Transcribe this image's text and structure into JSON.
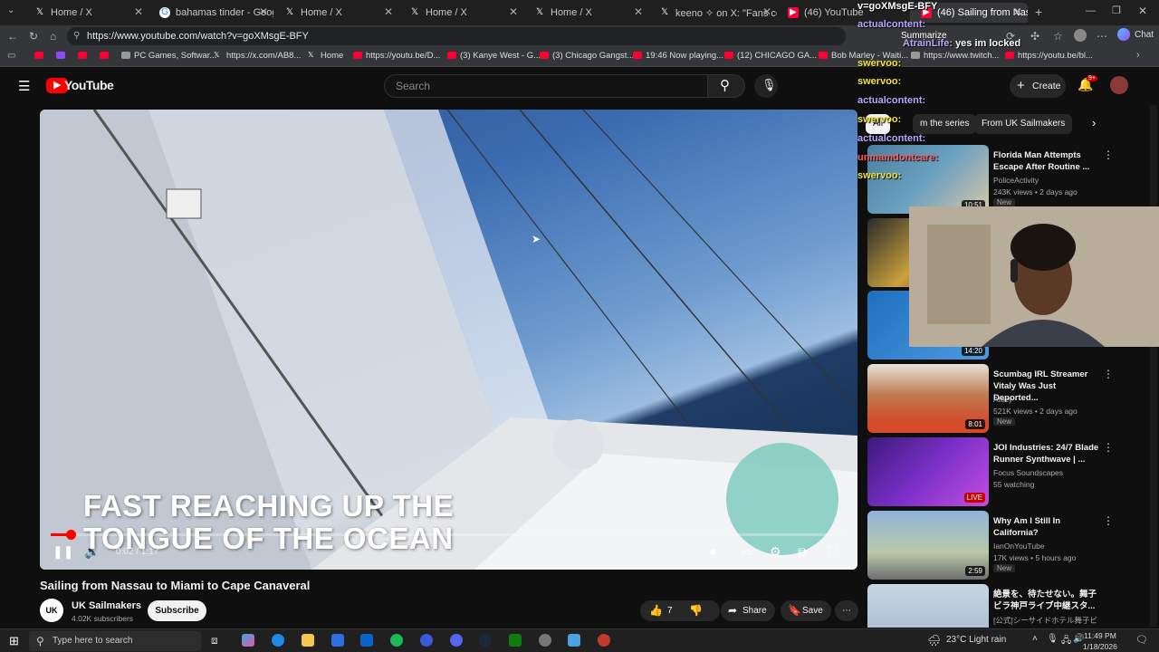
{
  "browser": {
    "tabs": [
      {
        "label": "Home / X",
        "icon": "x-logo-icon"
      },
      {
        "label": "bahamas tinder - Google Se",
        "icon": "google-icon"
      },
      {
        "label": "Home / X",
        "icon": "x-logo-icon"
      },
      {
        "label": "Home / X",
        "icon": "x-logo-icon"
      },
      {
        "label": "Home / X",
        "icon": "x-logo-icon"
      },
      {
        "label": "keeno ✧ on X: \"Fans compa",
        "icon": "x-logo-icon"
      },
      {
        "label": "(46) YouTube",
        "icon": "youtube-icon"
      },
      {
        "label": "(46) Sailing from Nassau",
        "icon": "youtube-icon"
      }
    ],
    "url": "https://www.youtube.com/watch?v=goXMsgE-BFY",
    "bookmarks": [
      "PC Games, Softwar...",
      "https://x.com/AB8...",
      "Home",
      "https://youtu.be/D...",
      "(3) Kanye West - G...",
      "(3) Chicago Gangst...",
      "19:46 Now playing...",
      "(12) CHICAGO GA...",
      "Bob Marley - Waiti...",
      "https://www.twitch...",
      "https://youtu.be/bl..."
    ],
    "summarize_label": "Summarize",
    "chat_label": "Chat"
  },
  "youtube": {
    "logo_text": "YouTube",
    "search_placeholder": "Search",
    "create_label": "Create",
    "notif_count": "9+"
  },
  "video": {
    "caption_line1": "FAST REACHING UP THE",
    "caption_line2": "TONGUE OF THE OCEAN",
    "time": "0:02 / 1:17",
    "progress": 0.026,
    "title": "Sailing from Nassau to Miami to Cape Canaveral",
    "channel": "UK Sailmakers",
    "channel_avatar_text": "UK",
    "subscribers": "4.02K subscribers",
    "subscribe_label": "Subscribe",
    "likes": "7",
    "share_label": "Share",
    "save_label": "Save"
  },
  "chips": [
    "All",
    "m the series",
    "From UK Sailmakers"
  ],
  "recommendations": [
    {
      "title": "Florida Man Attempts Escape After Routine ...",
      "channel": "PoliceActivity",
      "meta": "243K views • 2 days ago",
      "badge": "New",
      "duration": "10:51"
    },
    {
      "title": "",
      "channel": "",
      "meta": "",
      "badge": "",
      "duration": ""
    },
    {
      "title": "",
      "channel": "",
      "meta": "",
      "badge": "",
      "duration": "14:20"
    },
    {
      "title": "Scumbag IRL Streamer Vitaly Was Just Deported...",
      "channel": "Atozy",
      "meta": "521K views • 2 days ago",
      "badge": "New",
      "duration": "8:01"
    },
    {
      "title": "JOI Industries: 24/7 Blade Runner Synthwave | ...",
      "channel": "Focus Soundscapes",
      "meta": "55 watching",
      "badge": "",
      "duration": "LIVE"
    },
    {
      "title": "Why Am I Still In California?",
      "channel": "IanOnYouTube",
      "meta": "17K views • 5 hours ago",
      "badge": "New",
      "duration": "2:59"
    },
    {
      "title": "絶景を、待たせない。舞子ビラ神戸ライブ中継スタ...",
      "channel": "[公式]シーサイドホテル舞子ビラ...",
      "meta": "",
      "badge": "",
      "duration": ""
    }
  ],
  "chat_overlay": {
    "header": "v=goXMsgE-BFY",
    "lines": [
      {
        "user": "actualcontent:",
        "text": "",
        "color": "#b9a7ff"
      },
      {
        "user": "AtrainLife:",
        "text": "yes im locked",
        "color": "#b9a7ff"
      },
      {
        "user": "swervoo:",
        "text": "",
        "color": "#f5e23a"
      },
      {
        "user": "swervoo:",
        "text": "",
        "color": "#f5e23a"
      },
      {
        "user": "actualcontent:",
        "text": "",
        "color": "#b9a7ff"
      },
      {
        "user": "swervoo:",
        "text": "",
        "color": "#f5e23a"
      },
      {
        "user": "actualcontent:",
        "text": "",
        "color": "#b9a7ff"
      },
      {
        "user": "unmamdontcare:",
        "text": "",
        "color": "#ff5c5c"
      },
      {
        "user": "swervoo:",
        "text": "",
        "color": "#f5e23a"
      }
    ]
  },
  "taskbar": {
    "search_placeholder": "Type here to search",
    "weather": "23°C Light rain",
    "time": "11:49 PM",
    "date": "1/18/2026"
  }
}
